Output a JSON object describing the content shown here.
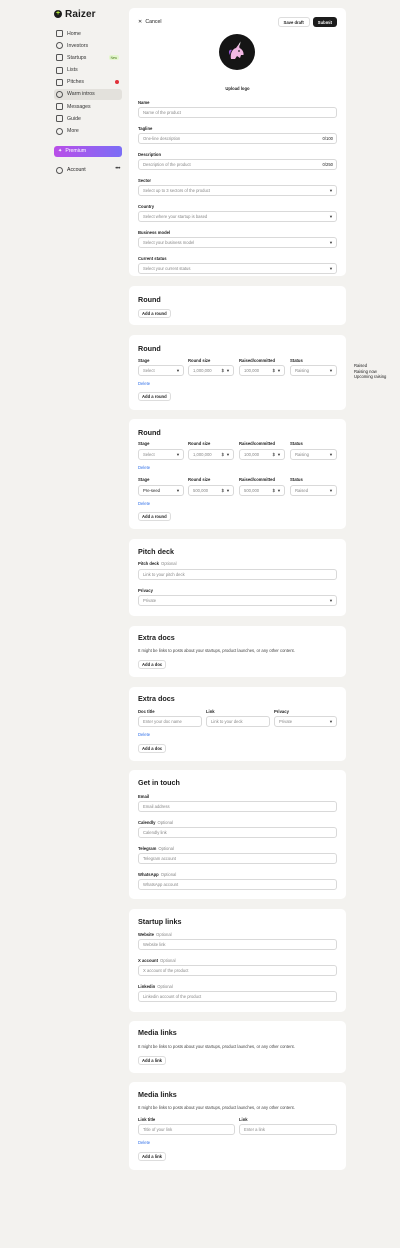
{
  "brand": {
    "name": "Raizer"
  },
  "sidebar": {
    "items": [
      {
        "label": "Home",
        "icon": "home-icon"
      },
      {
        "label": "Investors",
        "icon": "search-icon"
      },
      {
        "label": "Startups",
        "icon": "rocket-icon",
        "badge": "New"
      },
      {
        "label": "Lists",
        "icon": "list-icon"
      },
      {
        "label": "Pitches",
        "icon": "pitch-icon"
      },
      {
        "label": "Warm intros",
        "icon": "flame-icon"
      },
      {
        "label": "Messages",
        "icon": "mail-icon"
      },
      {
        "label": "Guide",
        "icon": "book-icon"
      },
      {
        "label": "More",
        "icon": "more-icon"
      }
    ],
    "premium": "Premium",
    "account": "Account",
    "account_menu": "•••"
  },
  "topbar": {
    "cancel": "Cancel",
    "save_draft": "Save draft",
    "submit": "Submit",
    "upload_logo": "Upload logo"
  },
  "product": {
    "name_label": "Name",
    "name_placeholder": "Name of the product",
    "tagline_label": "Tagline",
    "tagline_placeholder": "One-line description",
    "tagline_counter": "0/100",
    "description_label": "Description",
    "description_placeholder": "Description of the product",
    "description_counter": "0/250",
    "sector_label": "Sector",
    "sector_placeholder": "Select up to 3 sectors of the product",
    "country_label": "Country",
    "country_placeholder": "Select where your startup is based",
    "model_label": "Business model",
    "model_placeholder": "Select your business model",
    "status_label": "Current status",
    "status_placeholder": "Select your current status"
  },
  "round_empty": {
    "title": "Round",
    "add": "Add a round"
  },
  "round_one": {
    "title": "Round",
    "cols": {
      "stage": "Stage",
      "size": "Round size",
      "raised": "Raised/committed",
      "status": "Status"
    },
    "row": {
      "stage": "Select",
      "size": "1,000,000",
      "size_cur": "$",
      "raised": "100,000",
      "raised_cur": "$",
      "status": "Raising"
    },
    "delete": "Delete",
    "add": "Add a round"
  },
  "status_options": {
    "o1": "Raised",
    "o2": "Raising now",
    "o3": "Upcoming raising"
  },
  "round_two": {
    "title": "Round",
    "cols": {
      "stage": "Stage",
      "size": "Round size",
      "raised": "Raised/committed",
      "status": "Status"
    },
    "row1": {
      "stage": "Select",
      "size": "1,000,000",
      "size_cur": "$",
      "raised": "100,000",
      "raised_cur": "$",
      "status": "Raising"
    },
    "row2": {
      "stage": "Pre-seed",
      "size": "500,000",
      "size_cur": "$",
      "raised": "500,000",
      "raised_cur": "$",
      "status": "Raised"
    },
    "delete": "Delete",
    "add": "Add a round"
  },
  "pitch": {
    "title": "Pitch deck",
    "deck_label": "Pitch deck",
    "optional": "Optional",
    "deck_placeholder": "Link to your pitch deck",
    "privacy_label": "Privacy",
    "privacy_value": "Private"
  },
  "extra_empty": {
    "title": "Extra docs",
    "desc": "It might be links to posts about your startups, product launches, or any other content.",
    "add": "Add a doc"
  },
  "extra_one": {
    "title": "Extra docs",
    "doc_title_label": "Doc title",
    "doc_title_placeholder": "Enter your doc name",
    "link_label": "Link",
    "link_placeholder": "Link to your deck",
    "privacy_label": "Privacy",
    "privacy_value": "Private",
    "delete": "Delete",
    "add": "Add a doc"
  },
  "contact": {
    "title": "Get in touch",
    "optional": "Optional",
    "email_label": "Email",
    "email_placeholder": "Email address",
    "calendly_label": "Calendly",
    "calendly_placeholder": "Calendly link",
    "telegram_label": "Telegram",
    "telegram_placeholder": "Telegram account",
    "whatsapp_label": "WhatsApp",
    "whatsapp_placeholder": "WhatsApp account"
  },
  "links": {
    "title": "Startup links",
    "optional": "Optional",
    "website_label": "Website",
    "website_placeholder": "Website link",
    "x_label": "X account",
    "x_placeholder": "X account of the product",
    "linkedin_label": "Linkedin",
    "linkedin_placeholder": "Linkedin account of the product"
  },
  "media_empty": {
    "title": "Media links",
    "desc": "It might be links to posts about your startups, product launches, or any other content.",
    "add": "Add a link"
  },
  "media_one": {
    "title": "Media links",
    "desc": "It might be links to posts about your startups, product launches, or any other content.",
    "link_title_label": "Link title",
    "link_title_placeholder": "Title of your link",
    "link_label": "Link",
    "link_placeholder": "Enter a link",
    "delete": "Delete",
    "add": "Add a link"
  },
  "colors": {
    "accent_dark": "#1c1c1c",
    "brand_green": "#b9f23a",
    "link_blue": "#2f6fe8",
    "premium_from": "#b94ee8",
    "premium_to": "#7b6ef6"
  }
}
